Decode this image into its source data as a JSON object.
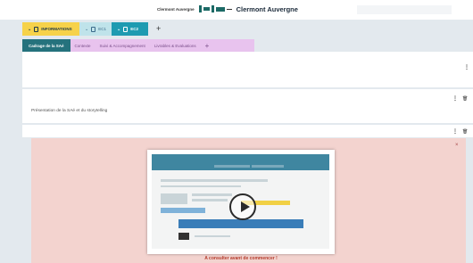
{
  "header": {
    "logo_small": "Clermont Auvergne",
    "logo_big": "Clermont Auvergne",
    "logo_mark": "logo-mark-icon"
  },
  "main_tabs": [
    {
      "label": "INFORMATIONS",
      "icon": "document-icon",
      "color": "#f6d24a"
    },
    {
      "label": "EC1",
      "icon": "document-icon",
      "color": "#bfe3ea"
    },
    {
      "label": "EC2",
      "icon": "document-icon",
      "color": "#1e9bb1"
    }
  ],
  "sub_tabs": [
    {
      "label": "Cadrage de la SAé",
      "active": true
    },
    {
      "label": "Contexte"
    },
    {
      "label": "Suivi & Accompagnement"
    },
    {
      "label": "Livrables & Evaluations"
    }
  ],
  "add_tab_label": "+",
  "panels": {
    "section2_title": "Présentation de la SAé et du storytelling"
  },
  "banner": {
    "close_label": "×",
    "caption": "A consulter avant de commencer !",
    "video_icon": "play-icon",
    "bg_color": "#f3d3cf"
  },
  "icons": {
    "more": "⋮",
    "trash": "🗑"
  }
}
